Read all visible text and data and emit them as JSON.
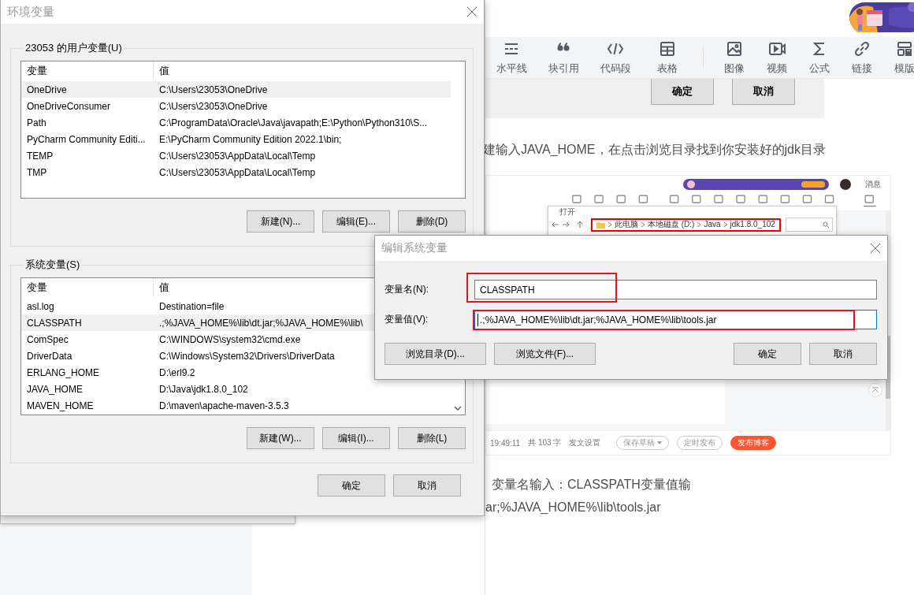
{
  "banner": {
    "kind": "picture"
  },
  "editor_toolbar": {
    "groups": [
      [
        {
          "label": "水平线"
        },
        {
          "label": "块引用"
        },
        {
          "label": "代码段"
        },
        {
          "label": "表格"
        }
      ],
      [
        {
          "label": "图像"
        },
        {
          "label": "视频"
        },
        {
          "label": "公式"
        },
        {
          "label": "链接"
        },
        {
          "label": "模版"
        }
      ]
    ]
  },
  "snippet_buttons": [
    "确定",
    "取消"
  ],
  "article": {
    "intro": "建输入JAVA_HOME，在点击浏览目录找到你安装好的jdk目录",
    "outro_lines": [
      "变量名输入：CLASSPATH变量值输",
      "ar;%JAVA_HOME%\\lib\\tools.jar"
    ]
  },
  "embedded_screenshot": {
    "user_label": "消息",
    "open_dialog": {
      "title": "打开",
      "breadcrumb": [
        "此电脑",
        "本地磁盘 (D:)",
        "Java",
        "jdk1.8.0_102"
      ]
    },
    "status": [
      "19:49:11",
      "共 103 字",
      "发文设置"
    ],
    "buttons": [
      {
        "label": "保存草稿",
        "kind": "dropdown"
      },
      {
        "label": "定时发布",
        "kind": "outline"
      },
      {
        "label": "发布博客",
        "kind": "primary"
      }
    ]
  },
  "env_window": {
    "title": "环境变量",
    "groups": [
      {
        "legend": "23053 的用户变量(U)",
        "columns": [
          "变量",
          "值"
        ],
        "scrollbar": false,
        "rows": [
          {
            "name": "OneDrive",
            "value": "C:\\Users\\23053\\OneDrive",
            "selected": true
          },
          {
            "name": "OneDriveConsumer",
            "value": "C:\\Users\\23053\\OneDrive",
            "selected": false
          },
          {
            "name": "Path",
            "value": "C:\\ProgramData\\Oracle\\Java\\javapath;E:\\Python\\Python310\\S...",
            "selected": false
          },
          {
            "name": "PyCharm Community Editi...",
            "value": "E:\\PyCharm Community Edition 2022.1\\bin;",
            "selected": false
          },
          {
            "name": "TEMP",
            "value": "C:\\Users\\23053\\AppData\\Local\\Temp",
            "selected": false
          },
          {
            "name": "TMP",
            "value": "C:\\Users\\23053\\AppData\\Local\\Temp",
            "selected": false
          }
        ],
        "buttons": [
          "新建(N)...",
          "编辑(E)...",
          "删除(D)"
        ]
      },
      {
        "legend": "系统变量(S)",
        "columns": [
          "变量",
          "值"
        ],
        "scrollbar": true,
        "rows": [
          {
            "name": "asl.log",
            "value": "Destination=file",
            "selected": false
          },
          {
            "name": "CLASSPATH",
            "value": ".;%JAVA_HOME%\\lib\\dt.jar;%JAVA_HOME%\\lib\\",
            "selected": true
          },
          {
            "name": "ComSpec",
            "value": "C:\\WINDOWS\\system32\\cmd.exe",
            "selected": false
          },
          {
            "name": "DriverData",
            "value": "C:\\Windows\\System32\\Drivers\\DriverData",
            "selected": false
          },
          {
            "name": "ERLANG_HOME",
            "value": "D:\\erl9.2",
            "selected": false
          },
          {
            "name": "JAVA_HOME",
            "value": "D:\\Java\\jdk1.8.0_102",
            "selected": false
          },
          {
            "name": "MAVEN_HOME",
            "value": "D:\\maven\\apache-maven-3.5.3",
            "selected": false
          }
        ],
        "buttons": [
          "新建(W)...",
          "编辑(I)...",
          "删除(L)"
        ]
      }
    ],
    "buttons": [
      "确定",
      "取消"
    ]
  },
  "edit_dialog": {
    "title": "编辑系统变量",
    "fields": [
      {
        "label": "变量名(N):",
        "value": "CLASSPATH",
        "focused": false,
        "annotated": true
      },
      {
        "label": "变量值(V):",
        "value": ".;%JAVA_HOME%\\lib\\dt.jar;%JAVA_HOME%\\lib\\tools.jar",
        "focused": true,
        "annotated": true
      }
    ],
    "left_buttons": [
      "浏览目录(D)...",
      "浏览文件(F)..."
    ],
    "right_buttons": [
      "确定",
      "取消"
    ]
  }
}
